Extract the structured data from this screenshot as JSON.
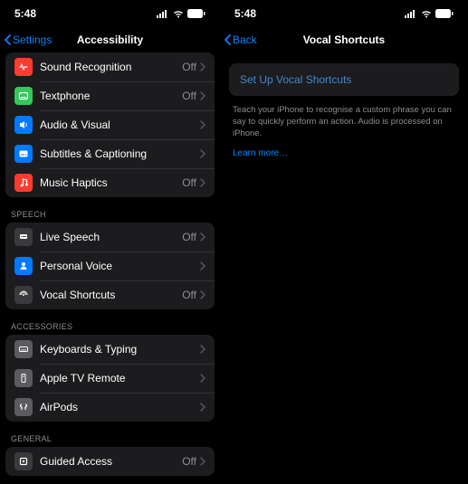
{
  "left": {
    "status": {
      "time": "5:48"
    },
    "nav": {
      "back": "Settings",
      "title": "Accessibility"
    },
    "groups": [
      {
        "header": null,
        "rows": [
          {
            "name": "sound-recognition",
            "label": "Sound Recognition",
            "value": "Off",
            "icon": "sound-recognition-icon",
            "iconClass": "ic-red"
          },
          {
            "name": "textphone",
            "label": "Textphone",
            "value": "Off",
            "icon": "textphone-icon",
            "iconClass": "ic-green"
          },
          {
            "name": "audio-visual",
            "label": "Audio & Visual",
            "value": null,
            "icon": "audio-visual-icon",
            "iconClass": "ic-blue"
          },
          {
            "name": "subtitles",
            "label": "Subtitles & Captioning",
            "value": null,
            "icon": "subtitles-icon",
            "iconClass": "ic-blue"
          },
          {
            "name": "music-haptics",
            "label": "Music Haptics",
            "value": "Off",
            "icon": "music-haptics-icon",
            "iconClass": "ic-red"
          }
        ]
      },
      {
        "header": "SPEECH",
        "rows": [
          {
            "name": "live-speech",
            "label": "Live Speech",
            "value": "Off",
            "icon": "live-speech-icon",
            "iconClass": "ic-dkgray"
          },
          {
            "name": "personal-voice",
            "label": "Personal Voice",
            "value": null,
            "icon": "personal-voice-icon",
            "iconClass": "ic-blue"
          },
          {
            "name": "vocal-shortcuts",
            "label": "Vocal Shortcuts",
            "value": "Off",
            "icon": "vocal-shortcuts-icon",
            "iconClass": "ic-dkgray"
          }
        ]
      },
      {
        "header": "ACCESSORIES",
        "rows": [
          {
            "name": "keyboards-typing",
            "label": "Keyboards & Typing",
            "value": null,
            "icon": "keyboard-icon",
            "iconClass": "ic-gray"
          },
          {
            "name": "apple-tv-remote",
            "label": "Apple TV Remote",
            "value": null,
            "icon": "tv-remote-icon",
            "iconClass": "ic-gray"
          },
          {
            "name": "airpods",
            "label": "AirPods",
            "value": null,
            "icon": "airpods-icon",
            "iconClass": "ic-gray"
          }
        ]
      },
      {
        "header": "GENERAL",
        "rows": [
          {
            "name": "guided-access",
            "label": "Guided Access",
            "value": "Off",
            "icon": "guided-access-icon",
            "iconClass": "ic-dkgray"
          }
        ]
      }
    ]
  },
  "right": {
    "status": {
      "time": "5:48"
    },
    "nav": {
      "back": "Back",
      "title": "Vocal Shortcuts"
    },
    "setup_label": "Set Up Vocal Shortcuts",
    "helper": "Teach your iPhone to recognise a custom phrase you can say to quickly perform an action. Audio is processed on iPhone.",
    "learn_more": "Learn more…"
  }
}
